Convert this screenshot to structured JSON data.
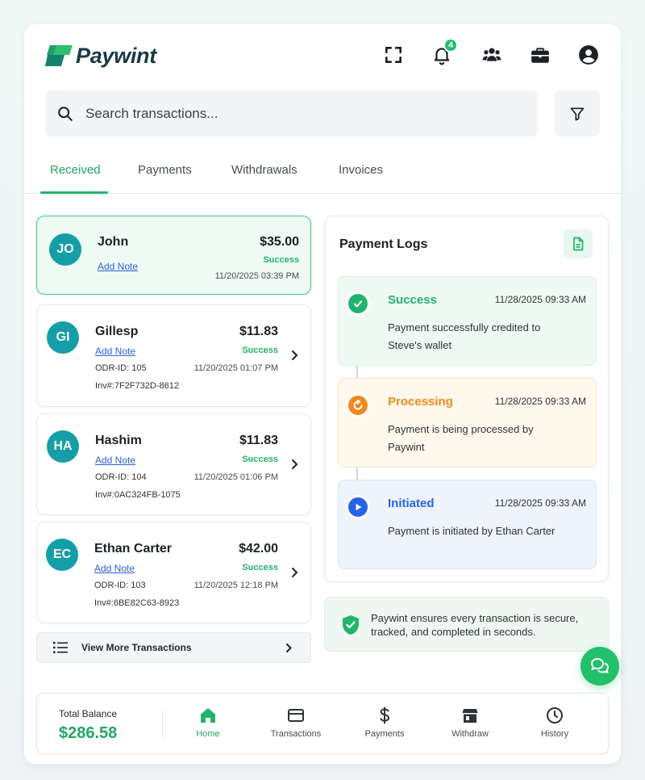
{
  "brand": {
    "name": "Paywint",
    "accent": "#22b46b"
  },
  "header": {
    "notification_count": "4"
  },
  "search": {
    "placeholder": "Search transactions..."
  },
  "tabs": [
    {
      "label": "Received",
      "active": true
    },
    {
      "label": "Payments",
      "active": false
    },
    {
      "label": "Withdrawals",
      "active": false
    },
    {
      "label": "Invoices",
      "active": false
    }
  ],
  "transactions": [
    {
      "initials": "JO",
      "name": "John",
      "note_label": "Add Note",
      "amount": "$35.00",
      "status": "Success",
      "date": "11/20/2025 03:39 PM",
      "selected": true
    },
    {
      "initials": "GI",
      "name": "Gillesp",
      "note_label": "Add Note",
      "amount": "$11.83",
      "status": "Success",
      "date": "11/20/2025 01:07 PM",
      "odr": "ODR-ID:  105",
      "inv": "Inv#:7F2F732D-8612"
    },
    {
      "initials": "HA",
      "name": "Hashim",
      "note_label": "Add Note",
      "amount": "$11.83",
      "status": "Success",
      "date": "11/20/2025 01:06 PM",
      "odr": "ODR-ID:  104",
      "inv": "Inv#:0AC324FB-1075"
    },
    {
      "initials": "EC",
      "name": "Ethan Carter",
      "note_label": "Add Note",
      "amount": "$42.00",
      "status": "Success",
      "date": "11/20/2025 12:18 PM",
      "odr": "ODR-ID:  103",
      "inv": "Inv#:6BE82C63-8923"
    }
  ],
  "view_more_label": "View More Transactions",
  "payment_logs": {
    "title": "Payment Logs",
    "entries": [
      {
        "status": "Success",
        "time": "11/28/2025 09:33 AM",
        "message": "Payment successfully credited to Steve's wallet",
        "color": "#22b46b"
      },
      {
        "status": "Processing",
        "time": "11/28/2025 09:33 AM",
        "message": "Payment is being processed by Paywint",
        "color": "#f08a1c"
      },
      {
        "status": "Initiated",
        "time": "11/28/2025 09:33 AM",
        "message": "Payment is initiated by Ethan Carter",
        "color": "#2563eb"
      }
    ]
  },
  "secure_note": "Paywint ensures every transaction is secure, tracked, and completed in seconds.",
  "balance": {
    "label": "Total Balance",
    "value": "$286.58"
  },
  "bottom_nav": [
    {
      "label": "Home",
      "icon": "home-icon",
      "active": true
    },
    {
      "label": "Transactions",
      "icon": "card-icon",
      "active": false
    },
    {
      "label": "Payments",
      "icon": "dollar-icon",
      "active": false
    },
    {
      "label": "Withdraw",
      "icon": "store-icon",
      "active": false
    },
    {
      "label": "History",
      "icon": "clock-icon",
      "active": false
    }
  ]
}
